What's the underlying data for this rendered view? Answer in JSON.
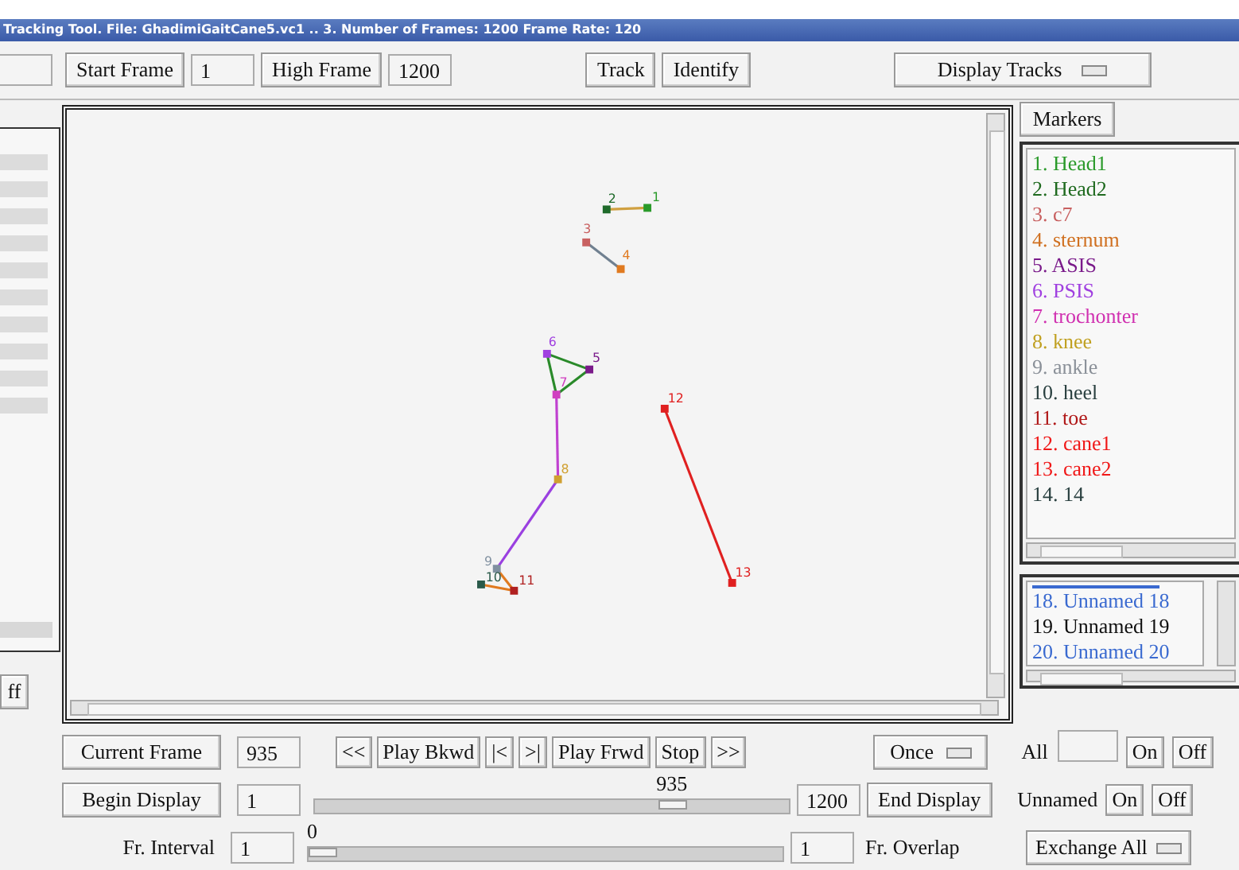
{
  "window": {
    "title": "Tracking Tool. File:  GhadimiGaitCane5.vc1 .. 3.   Number of Frames:  1200   Frame Rate:  120"
  },
  "toolbar": {
    "start_frame_button": "Start Frame",
    "start_frame_value": "1",
    "high_frame_button": "High Frame",
    "high_frame_value": "1200",
    "track_button": "Track",
    "identify_button": "Identify",
    "display_dropdown": "Display Tracks"
  },
  "left_panel": {
    "button": "ff"
  },
  "canvas": {
    "points": [
      {
        "label": "1",
        "color": "#2a9a2a"
      },
      {
        "label": "2",
        "color": "#1f6a2a"
      },
      {
        "label": "3",
        "color": "#c86060"
      },
      {
        "label": "4",
        "color": "#e07a20"
      },
      {
        "label": "5",
        "color": "#7a1a8a"
      },
      {
        "label": "6",
        "color": "#a040e0"
      },
      {
        "label": "7",
        "color": "#d040c0"
      },
      {
        "label": "8",
        "color": "#d0a030"
      },
      {
        "label": "9",
        "color": "#8090a0"
      },
      {
        "label": "10",
        "color": "#2a5a4a"
      },
      {
        "label": "11",
        "color": "#b02020"
      },
      {
        "label": "12",
        "color": "#e02020"
      },
      {
        "label": "13",
        "color": "#e02020"
      }
    ]
  },
  "markers": {
    "button": "Markers",
    "items": [
      {
        "text": "1. Head1",
        "color": "#2a9a2a"
      },
      {
        "text": "2. Head2",
        "color": "#1f6a1f"
      },
      {
        "text": "3. c7",
        "color": "#c86060"
      },
      {
        "text": "4. sternum",
        "color": "#d07020"
      },
      {
        "text": "5. ASIS",
        "color": "#7a1a8a"
      },
      {
        "text": "6. PSIS",
        "color": "#a040e0"
      },
      {
        "text": "7. trochonter",
        "color": "#d030b0"
      },
      {
        "text": "8. knee",
        "color": "#c0a020"
      },
      {
        "text": "9. ankle",
        "color": "#8a9098"
      },
      {
        "text": "10. heel",
        "color": "#2a4040"
      },
      {
        "text": "11. toe",
        "color": "#b01818"
      },
      {
        "text": "12. cane1",
        "color": "#f01818"
      },
      {
        "text": "13. cane2",
        "color": "#f01818"
      },
      {
        "text": "14. 14",
        "color": "#2a4040"
      }
    ]
  },
  "unnamed": {
    "items": [
      {
        "text": "18. Unnamed 18",
        "color": "#3a6ad0"
      },
      {
        "text": "19. Unnamed 19",
        "color": "#101010"
      },
      {
        "text": "20. Unnamed 20",
        "color": "#3a6ad0"
      }
    ]
  },
  "controls": {
    "current_frame_button": "Current Frame",
    "current_frame_value": "935",
    "playback_buttons": [
      "<<",
      "Play Bkwd",
      "|<",
      ">|",
      "Play Frwd",
      "Stop",
      ">>"
    ],
    "loop_dropdown": "Once",
    "all_label": "All",
    "all_on": "On",
    "all_off": "Off",
    "begin_display_button": "Begin Display",
    "begin_display_value": "1",
    "display_slider": {
      "reading": "935",
      "level": 0.77
    },
    "end_display_value": "1200",
    "end_display_button": "End Display",
    "unnamed_label": "Unnamed",
    "unnamed_on": "On",
    "unnamed_off": "Off",
    "interval_label": "Fr. Interval",
    "interval_value": "1",
    "interval_slider": {
      "reading": "0",
      "level": 0
    },
    "overlap_value": "1",
    "overlap_label": "Fr. Overlap",
    "exchange_dropdown": "Exchange All"
  }
}
